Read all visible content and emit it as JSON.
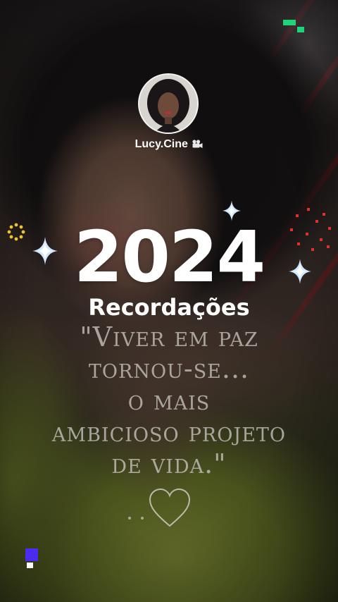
{
  "profile": {
    "username": "Lucy.Cine",
    "badge_icon": "movie-camera-icon"
  },
  "headline": {
    "year": "2024",
    "subtitle": "Recordações"
  },
  "quote": {
    "lines": [
      "\"Viver em paz",
      "tornou-se...",
      "o mais",
      "ambicioso projeto",
      "de vida.\""
    ]
  },
  "decorations": {
    "heart_icon": "heart-outline-icon",
    "sparkle_icon": "four-point-star-icon",
    "accent_colors": {
      "green": "#1ed47a",
      "red": "#e0302a",
      "yellow": "#f2c230",
      "blue": "#4a2cf0"
    }
  }
}
